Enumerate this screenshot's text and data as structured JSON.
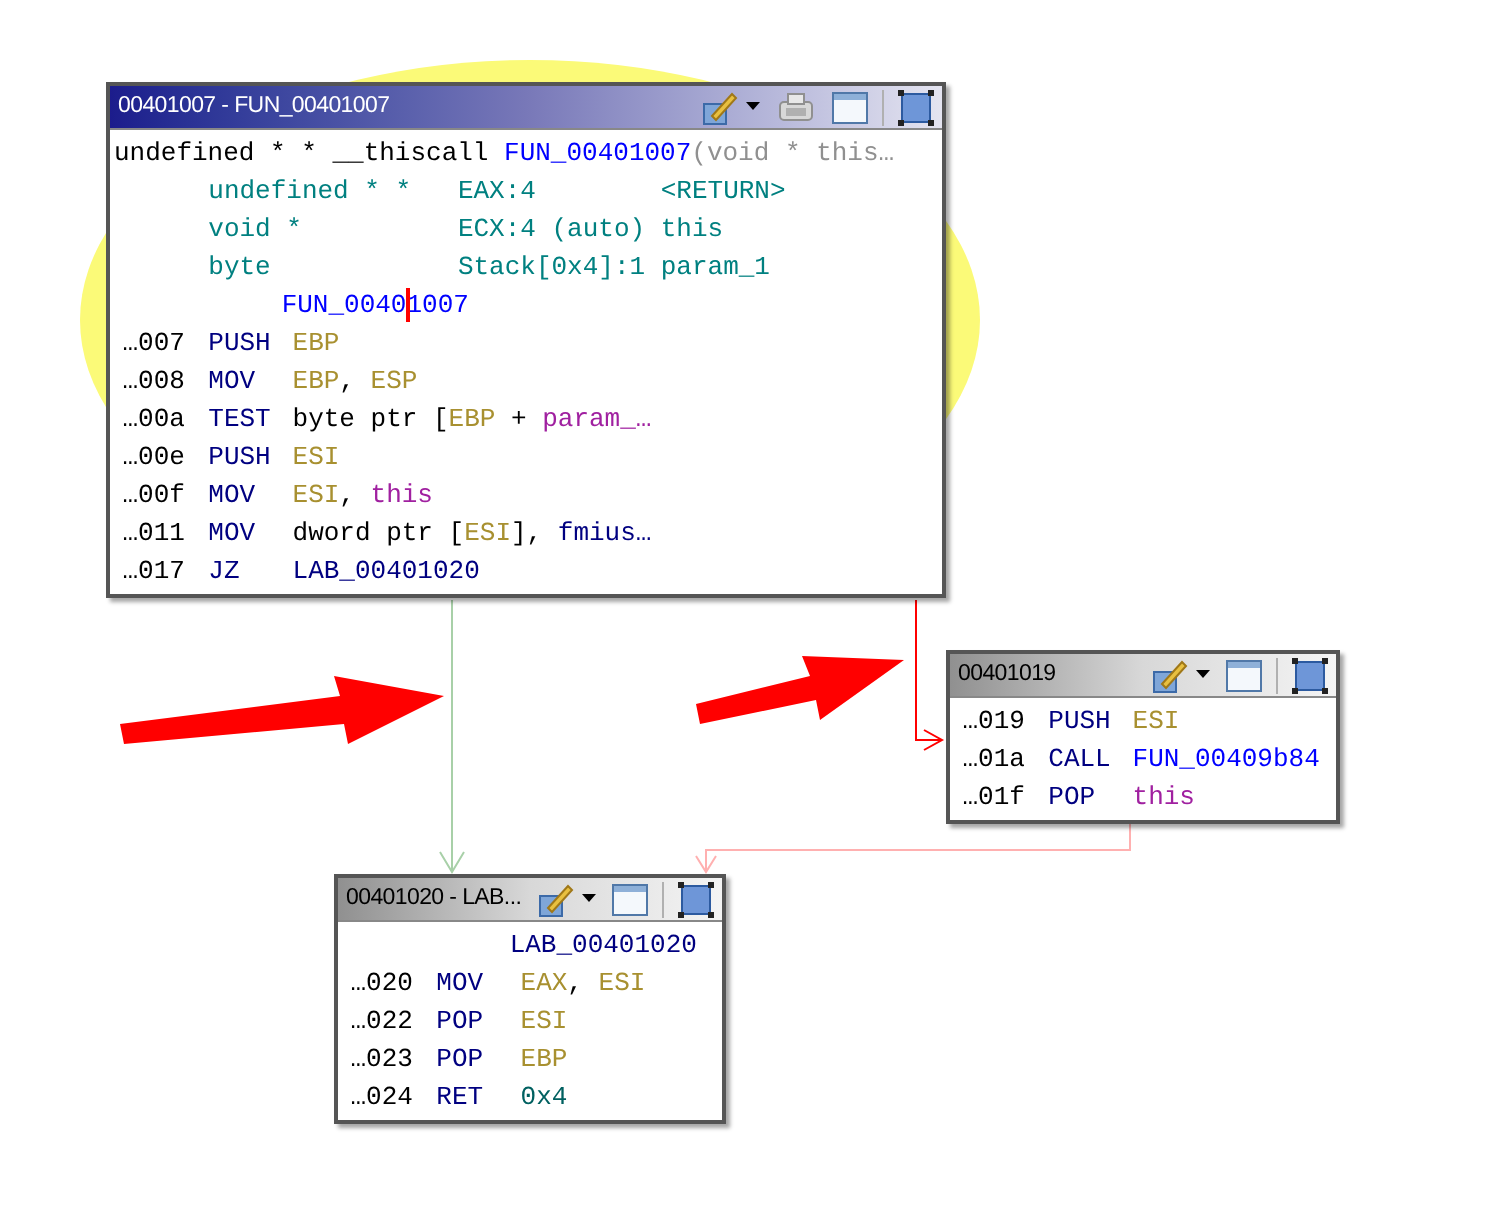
{
  "nodes": [
    {
      "title": "00401007 - FUN_00401007",
      "selected": true,
      "lines": [
        {
          "kind": "signature",
          "tokens": [
            {
              "text": "undefined * * __thiscall",
              "kind": "plain"
            },
            {
              "text": "FUN_00401007",
              "kind": "function"
            },
            {
              "text": "(void * this…",
              "kind": "muted"
            }
          ]
        },
        {
          "kind": "param",
          "type": "undefined * *",
          "storage": "EAX:4",
          "name": "<RETURN>"
        },
        {
          "kind": "param",
          "type": "void *",
          "storage": "ECX:4 (auto)",
          "name": "this"
        },
        {
          "kind": "param",
          "type": "byte",
          "storage": "Stack[0x4]:1",
          "name": "param_1"
        },
        {
          "kind": "label",
          "label": {
            "text": "FUN_00401007",
            "kind": "function"
          },
          "cursor": true
        },
        {
          "kind": "instruction",
          "address": "…007",
          "mnemonic": "PUSH",
          "operands": [
            {
              "text": "EBP",
              "kind": "register"
            }
          ]
        },
        {
          "kind": "instruction",
          "address": "…008",
          "mnemonic": "MOV",
          "operands": [
            {
              "text": "EBP",
              "kind": "register"
            },
            {
              "text": ", ",
              "kind": "plain"
            },
            {
              "text": "ESP",
              "kind": "register"
            }
          ]
        },
        {
          "kind": "instruction",
          "address": "…00a",
          "mnemonic": "TEST",
          "operands": [
            {
              "text": "byte ptr [",
              "kind": "plain"
            },
            {
              "text": "EBP",
              "kind": "register"
            },
            {
              "text": " + ",
              "kind": "plain"
            },
            {
              "text": "param_…",
              "kind": "variable"
            }
          ]
        },
        {
          "kind": "instruction",
          "address": "…00e",
          "mnemonic": "PUSH",
          "operands": [
            {
              "text": "ESI",
              "kind": "register"
            }
          ]
        },
        {
          "kind": "instruction",
          "address": "…00f",
          "mnemonic": "MOV",
          "operands": [
            {
              "text": "ESI",
              "kind": "register"
            },
            {
              "text": ", ",
              "kind": "plain"
            },
            {
              "text": "this",
              "kind": "variable"
            }
          ]
        },
        {
          "kind": "instruction",
          "address": "…011",
          "mnemonic": "MOV",
          "operands": [
            {
              "text": "dword ptr [",
              "kind": "plain"
            },
            {
              "text": "ESI",
              "kind": "register"
            },
            {
              "text": "], ",
              "kind": "plain"
            },
            {
              "text": "fmius…",
              "kind": "label"
            }
          ]
        },
        {
          "kind": "instruction",
          "address": "…017",
          "mnemonic": "JZ",
          "operands": [
            {
              "text": "LAB_00401020",
              "kind": "label"
            }
          ]
        }
      ]
    },
    {
      "title": "00401019",
      "selected": false,
      "lines": [
        {
          "kind": "instruction",
          "address": "…019",
          "mnemonic": "PUSH",
          "operands": [
            {
              "text": "ESI",
              "kind": "register"
            }
          ]
        },
        {
          "kind": "instruction",
          "address": "…01a",
          "mnemonic": "CALL",
          "operands": [
            {
              "text": "FUN_00409b84",
              "kind": "function"
            }
          ]
        },
        {
          "kind": "instruction",
          "address": "…01f",
          "mnemonic": "POP",
          "operands": [
            {
              "text": "this",
              "kind": "variable"
            }
          ]
        }
      ]
    },
    {
      "title": "00401020 - LAB...",
      "selected": false,
      "lines": [
        {
          "kind": "label",
          "label": {
            "text": "LAB_00401020",
            "kind": "label"
          },
          "cursor": false
        },
        {
          "kind": "instruction",
          "address": "…020",
          "mnemonic": "MOV",
          "operands": [
            {
              "text": "EAX",
              "kind": "register"
            },
            {
              "text": ", ",
              "kind": "plain"
            },
            {
              "text": "ESI",
              "kind": "register"
            }
          ]
        },
        {
          "kind": "instruction",
          "address": "…022",
          "mnemonic": "POP",
          "operands": [
            {
              "text": "ESI",
              "kind": "register"
            }
          ]
        },
        {
          "kind": "instruction",
          "address": "…023",
          "mnemonic": "POP",
          "operands": [
            {
              "text": "EBP",
              "kind": "register"
            }
          ]
        },
        {
          "kind": "instruction",
          "address": "…024",
          "mnemonic": "RET",
          "operands": [
            {
              "text": "0x4",
              "kind": "number"
            }
          ]
        }
      ]
    }
  ],
  "edges": [
    {
      "color": "#a8d0a8"
    },
    {
      "color": "#ff0000"
    },
    {
      "color": "#ffb0b0"
    }
  ]
}
